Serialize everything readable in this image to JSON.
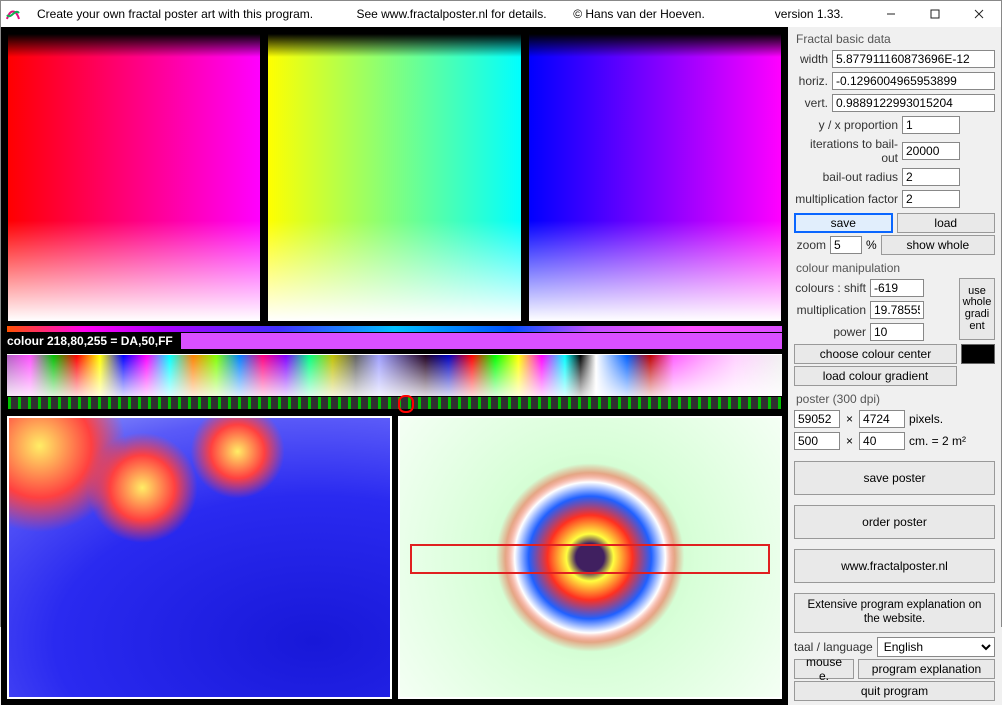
{
  "title": {
    "segments": "   Create your own fractal poster art with this program.             See www.fractalposter.nl for details.        © Hans van der Hoeven.                     version 1.33."
  },
  "colour_readout": "colour 218,80,255 = DA,50,FF",
  "basic": {
    "heading": "Fractal basic data",
    "width_label": "width",
    "width_value": "5.877911160873696E-12",
    "horiz_label": "horiz.",
    "horiz_value": "-0.1296004965953899",
    "vert_label": "vert.",
    "vert_value": "0.9889122993015204",
    "yx_label": "y / x proportion",
    "yx_value": "1",
    "iter_label": "iterations to bail-out",
    "iter_value": "20000",
    "bail_label": "bail-out radius",
    "bail_value": "2",
    "mult_label": "multiplication factor",
    "mult_value": "2",
    "save": "save",
    "load": "load",
    "zoom_label": "zoom",
    "zoom_value": "5",
    "zoom_pct": "%",
    "show_whole": "show whole"
  },
  "colour": {
    "heading": "colour manipulation",
    "shift_label": "colours : shift",
    "shift_value": "-619",
    "mult_label": "multiplication",
    "mult_value": "19.78555",
    "power_label": "power",
    "power_value": "10",
    "use_whole_gradient": "use whole gradi ent",
    "choose_center": "choose colour center",
    "load_gradient": "load colour gradient"
  },
  "poster": {
    "heading": "poster (300 dpi)",
    "px_w": "59052",
    "px_h": "4724",
    "px_unit": "pixels.",
    "cm_w": "500",
    "cm_h": "40",
    "cm_unit": "cm. = 2 m²"
  },
  "buttons": {
    "save_poster": "save poster",
    "order_poster": "order poster",
    "site": "www.fractalposter.nl",
    "explanation": "Extensive program explanation on the website."
  },
  "footer": {
    "lang_label": "taal / language",
    "lang_value": "English",
    "mouse": "mouse e.",
    "prog_exp": "program explanation",
    "quit": "quit program"
  }
}
